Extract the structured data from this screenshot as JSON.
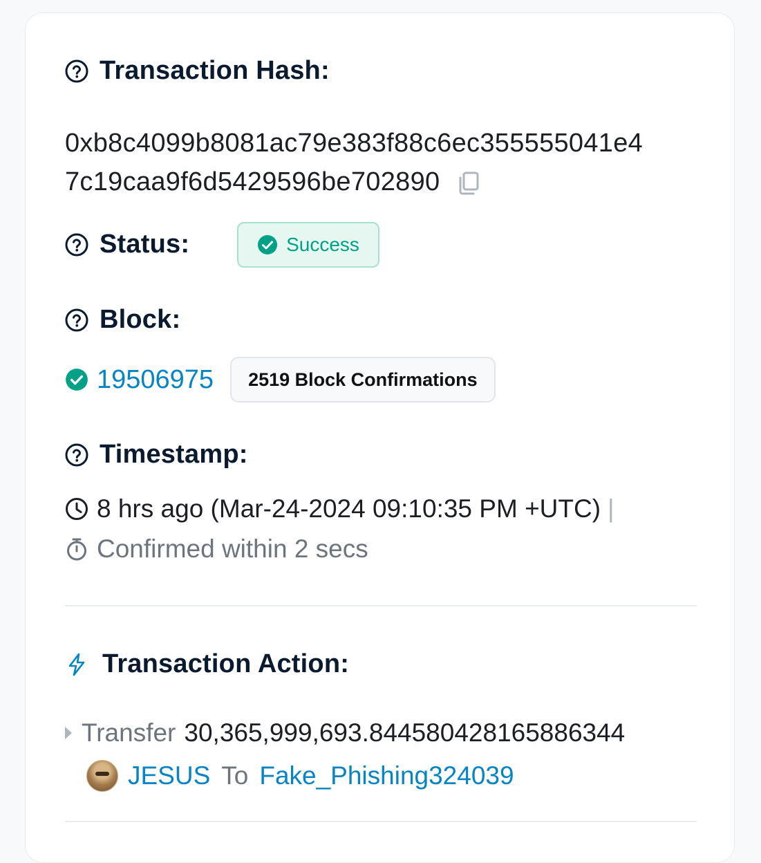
{
  "transaction_hash": {
    "label": "Transaction Hash:",
    "line1": "0xb8c4099b8081ac79e383f88c6ec355555041e4",
    "line2": "7c19caa9f6d5429596be702890"
  },
  "status": {
    "label": "Status:",
    "value": "Success",
    "color": "#00a186"
  },
  "block": {
    "label": "Block:",
    "number": "19506975",
    "confirmations": "2519 Block Confirmations"
  },
  "timestamp": {
    "label": "Timestamp:",
    "relative": "8 hrs ago (Mar-24-2024 09:10:35 PM +UTC)",
    "separator": "|",
    "confirmed": "Confirmed within 2 secs"
  },
  "transaction_action": {
    "label": "Transaction Action:",
    "verb": "Transfer",
    "amount": "30,365,999,693.844580428165886344",
    "token": "JESUS",
    "to_word": "To",
    "recipient": "Fake_Phishing324039"
  },
  "icons": {
    "help": "question-circle-icon",
    "copy": "copy-icon",
    "check": "check-circle-icon",
    "clock": "clock-icon",
    "stopwatch": "stopwatch-icon",
    "action": "lightning-icon",
    "caret": "caret-right-icon"
  },
  "colors": {
    "link": "#0784c3",
    "success": "#00a186",
    "text": "#081d35"
  }
}
